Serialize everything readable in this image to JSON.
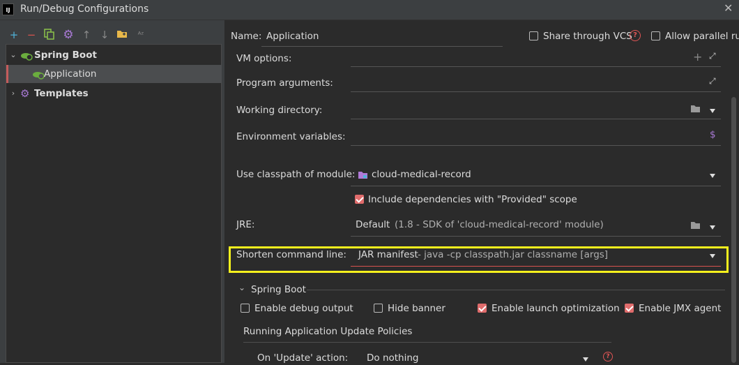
{
  "window": {
    "title": "Run/Debug Configurations",
    "app_icon": "IJ"
  },
  "toolbar": {
    "icons": [
      "add-icon",
      "remove-icon",
      "copy-icon",
      "settings-icon",
      "arrow-up-icon",
      "arrow-down-icon",
      "folder-icon",
      "sort-az-icon"
    ]
  },
  "tree": {
    "items": [
      {
        "label": "Spring Boot",
        "icon": "spring-boot-icon"
      },
      {
        "label": "Application",
        "icon": "spring-boot-app-icon"
      },
      {
        "label": "Templates",
        "icon": "gear-icon"
      }
    ]
  },
  "header": {
    "name_label": "Name:",
    "name_value": "Application",
    "share_label": "Share through VCS",
    "parallel_label": "Allow parallel run"
  },
  "form": {
    "vm_options_label": "VM options:",
    "program_args_label": "Program arguments:",
    "working_dir_label": "Working directory:",
    "env_vars_label": "Environment variables:",
    "env_vars_symbol": "$",
    "classpath_label": "Use classpath of module:",
    "classpath_value": "cloud-medical-record",
    "include_deps_label": "Include dependencies with \"Provided\" scope",
    "jre_label": "JRE:",
    "jre_value": "Default",
    "jre_detail": "(1.8 - SDK of 'cloud-medical-record' module)",
    "shorten_label": "Shorten command line:",
    "shorten_value": "JAR manifest",
    "shorten_detail": "- java -cp classpath.jar classname [args]"
  },
  "spring_boot": {
    "section_label": "Spring Boot",
    "debug_output_label": "Enable debug output",
    "hide_banner_label": "Hide banner",
    "launch_opt_label": "Enable launch optimization",
    "jmx_label": "Enable JMX agent",
    "policies_label": "Running Application Update Policies",
    "on_update_label": "On 'Update' action:",
    "on_update_value": "Do nothing"
  },
  "checkbox_states": {
    "share_vcs": false,
    "allow_parallel": false,
    "include_deps": true,
    "debug_output": false,
    "hide_banner": false,
    "launch_opt": true,
    "jmx": true
  },
  "colors": {
    "accent_red": "#e06c6c",
    "highlight_yellow": "#f5f01d",
    "folder_purple": "#b07ad8",
    "help_red": "#e05555"
  }
}
